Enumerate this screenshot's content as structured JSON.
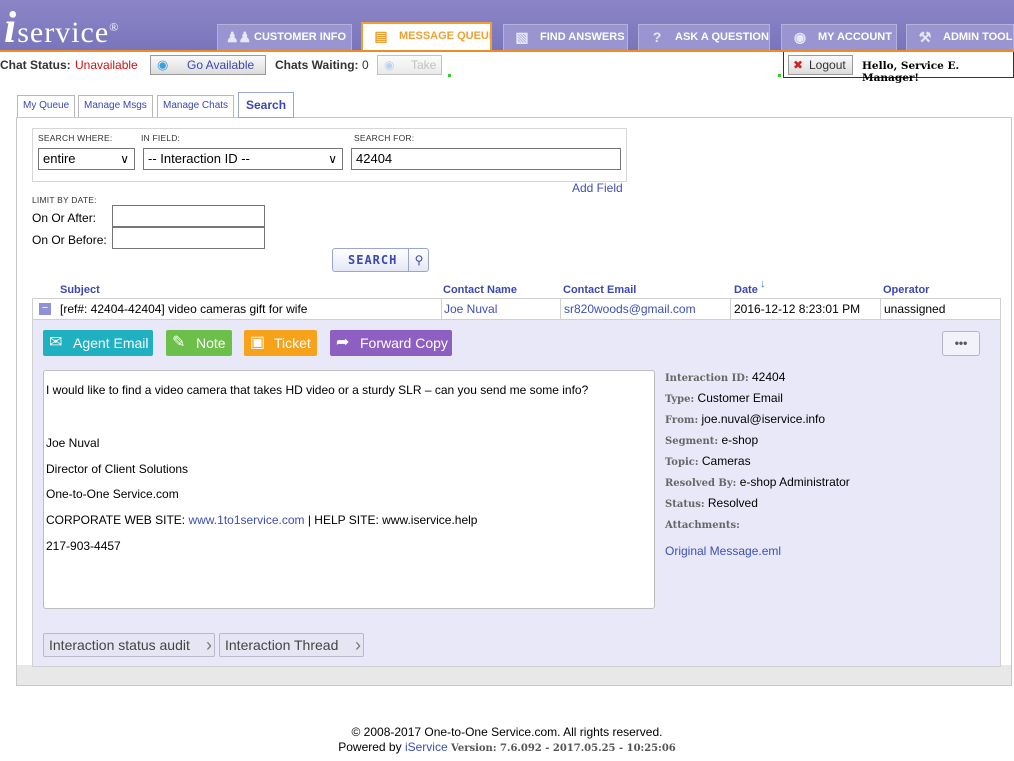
{
  "brand": {
    "logo_text": "service",
    "logo_i": "i",
    "registered": "®"
  },
  "nav": {
    "tabs": [
      {
        "label": "CUSTOMER INFO",
        "icon": "people-icon"
      },
      {
        "label": "MESSAGE QUEUE",
        "icon": "document-stack-icon"
      },
      {
        "label": "FIND ANSWERS",
        "icon": "book-icon"
      },
      {
        "label": "ASK A QUESTION",
        "icon": "question-icon"
      },
      {
        "label": "MY ACCOUNT",
        "icon": "eye-icon"
      },
      {
        "label": "ADMIN TOOLS",
        "icon": "wrench-icon"
      }
    ]
  },
  "status": {
    "chat_status_label": "Chat Status:",
    "chat_status_value": "Unavailable",
    "go_available": "Go Available",
    "chats_waiting_label": "Chats Waiting:",
    "chats_waiting_value": "0",
    "take": "Take",
    "logout": "Logout",
    "greeting": "Hello, Service E. Manager!"
  },
  "subtabs": [
    "My Queue",
    "Manage Msgs",
    "Manage Chats",
    "Search"
  ],
  "search": {
    "where_label": "SEARCH WHERE:",
    "where_value": "entire",
    "field_label": "IN FIELD:",
    "field_value": "-- Interaction ID --",
    "for_label": "SEARCH FOR:",
    "for_value": "42404",
    "add_field": "Add Field",
    "limit_label": "LIMIT BY DATE:",
    "after_label": "On Or After:",
    "before_label": "On Or Before:",
    "search_button": "SEARCH"
  },
  "results": {
    "columns": [
      "Subject",
      "Contact Name",
      "Contact Email",
      "Date",
      "Operator"
    ],
    "row": {
      "expand": "−",
      "subject": "[ref#: 42404-42404] video cameras gift for wife",
      "contact_name": "Joe Nuval",
      "contact_email": "sr820woods@gmail.com",
      "date": "2016-12-12 8:23:01 PM",
      "operator": "unassigned"
    }
  },
  "actions": {
    "agent_email": "Agent Email",
    "note": "Note",
    "ticket": "Ticket",
    "forward_copy": "Forward Copy",
    "more": "•••",
    "colors": {
      "agent_email": "#1fb1c1",
      "note": "#6cc04a",
      "ticket": "#f7a21b",
      "forward_copy": "#8d5fc2"
    }
  },
  "message": {
    "line1": "I would like to find a video camera that takes HD video or a sturdy SLR – can you send me some info?",
    "name": "Joe Nuval",
    "title": "Director of Client Solutions",
    "company": "One-to-One Service.com",
    "corp_label": "CORPORATE WEB SITE:",
    "corp_link": "www.1to1service.com",
    "help_label": "| HELP SITE: www.iservice.help",
    "phone": "217-903-4457"
  },
  "meta": {
    "interaction_id_label": "Interaction ID:",
    "interaction_id": "42404",
    "type_label": "Type:",
    "type": "Customer Email",
    "from_label": "From:",
    "from": "joe.nuval@iservice.info",
    "segment_label": "Segment:",
    "segment": "e-shop",
    "topic_label": "Topic:",
    "topic": "Cameras",
    "resolved_by_label": "Resolved By:",
    "resolved_by": "e-shop Administrator",
    "status_label": "Status:",
    "status": "Resolved",
    "attachments_label": "Attachments:",
    "attachment": "Original Message.eml"
  },
  "tabs_bottom": {
    "audit": "Interaction status audit",
    "thread": "Interaction Thread"
  },
  "footer": {
    "copyright": "© 2008-2017 One-to-One Service.com. All rights reserved.",
    "powered_by": "Powered by",
    "powered_link": "iService",
    "version": "Version: 7.6.092 - 2017.05.25 - 10:25:06"
  }
}
